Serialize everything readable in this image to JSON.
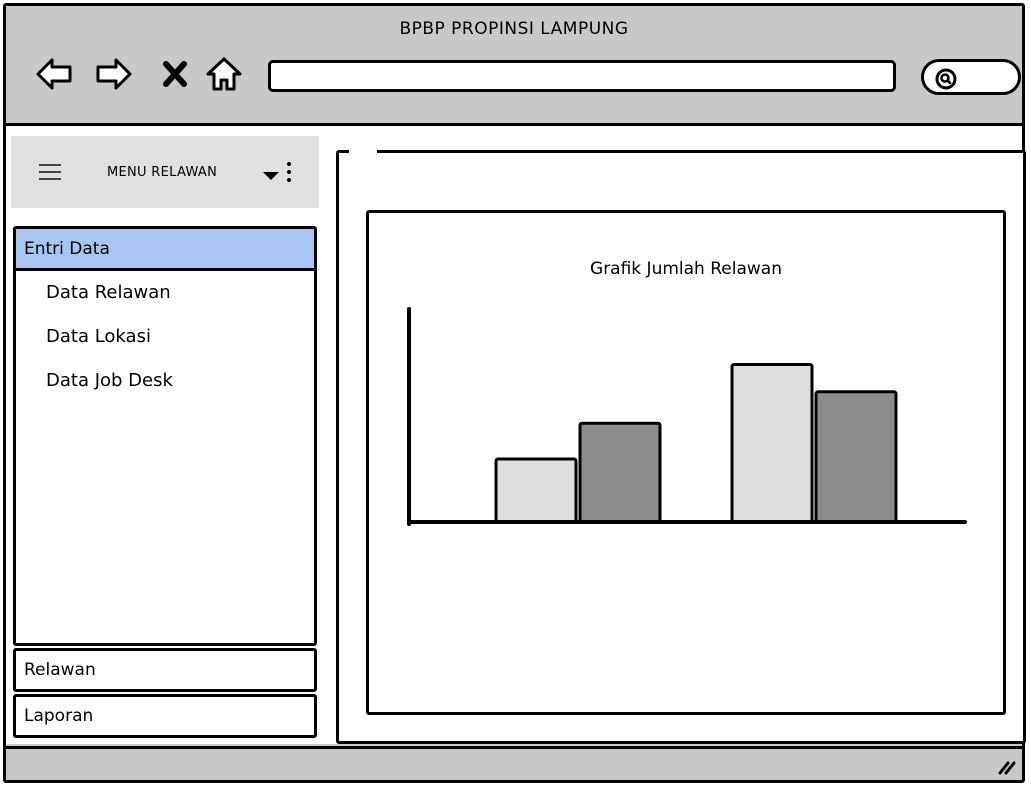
{
  "window": {
    "title": "BPBP PROPINSI LAMPUNG"
  },
  "toolbar": {
    "icons": [
      "back-arrow-icon",
      "forward-arrow-icon",
      "close-x-icon",
      "home-icon"
    ],
    "address_value": "",
    "search_icon": "search-icon"
  },
  "sidebar": {
    "header_label": "MENU RELAWAN",
    "section_label": "Entri Data",
    "items": [
      {
        "label": "Data Relawan"
      },
      {
        "label": "Data Lokasi"
      },
      {
        "label": "Data Job Desk"
      }
    ],
    "bottom_buttons": [
      {
        "label": "Relawan"
      },
      {
        "label": "Laporan"
      }
    ]
  },
  "colors": {
    "chrome": "#c8c8c8",
    "selected": "#a9c6f2",
    "series_light": "#dedede",
    "series_dark": "#8c8c8c"
  },
  "chart_data": {
    "type": "bar",
    "title": "Grafik Jumlah Relawan",
    "categories": [
      "",
      ""
    ],
    "series": [
      {
        "values": [
          30,
          75
        ]
      },
      {
        "values": [
          47,
          62
        ]
      }
    ],
    "ylim": [
      0,
      100
    ],
    "grid": false
  }
}
